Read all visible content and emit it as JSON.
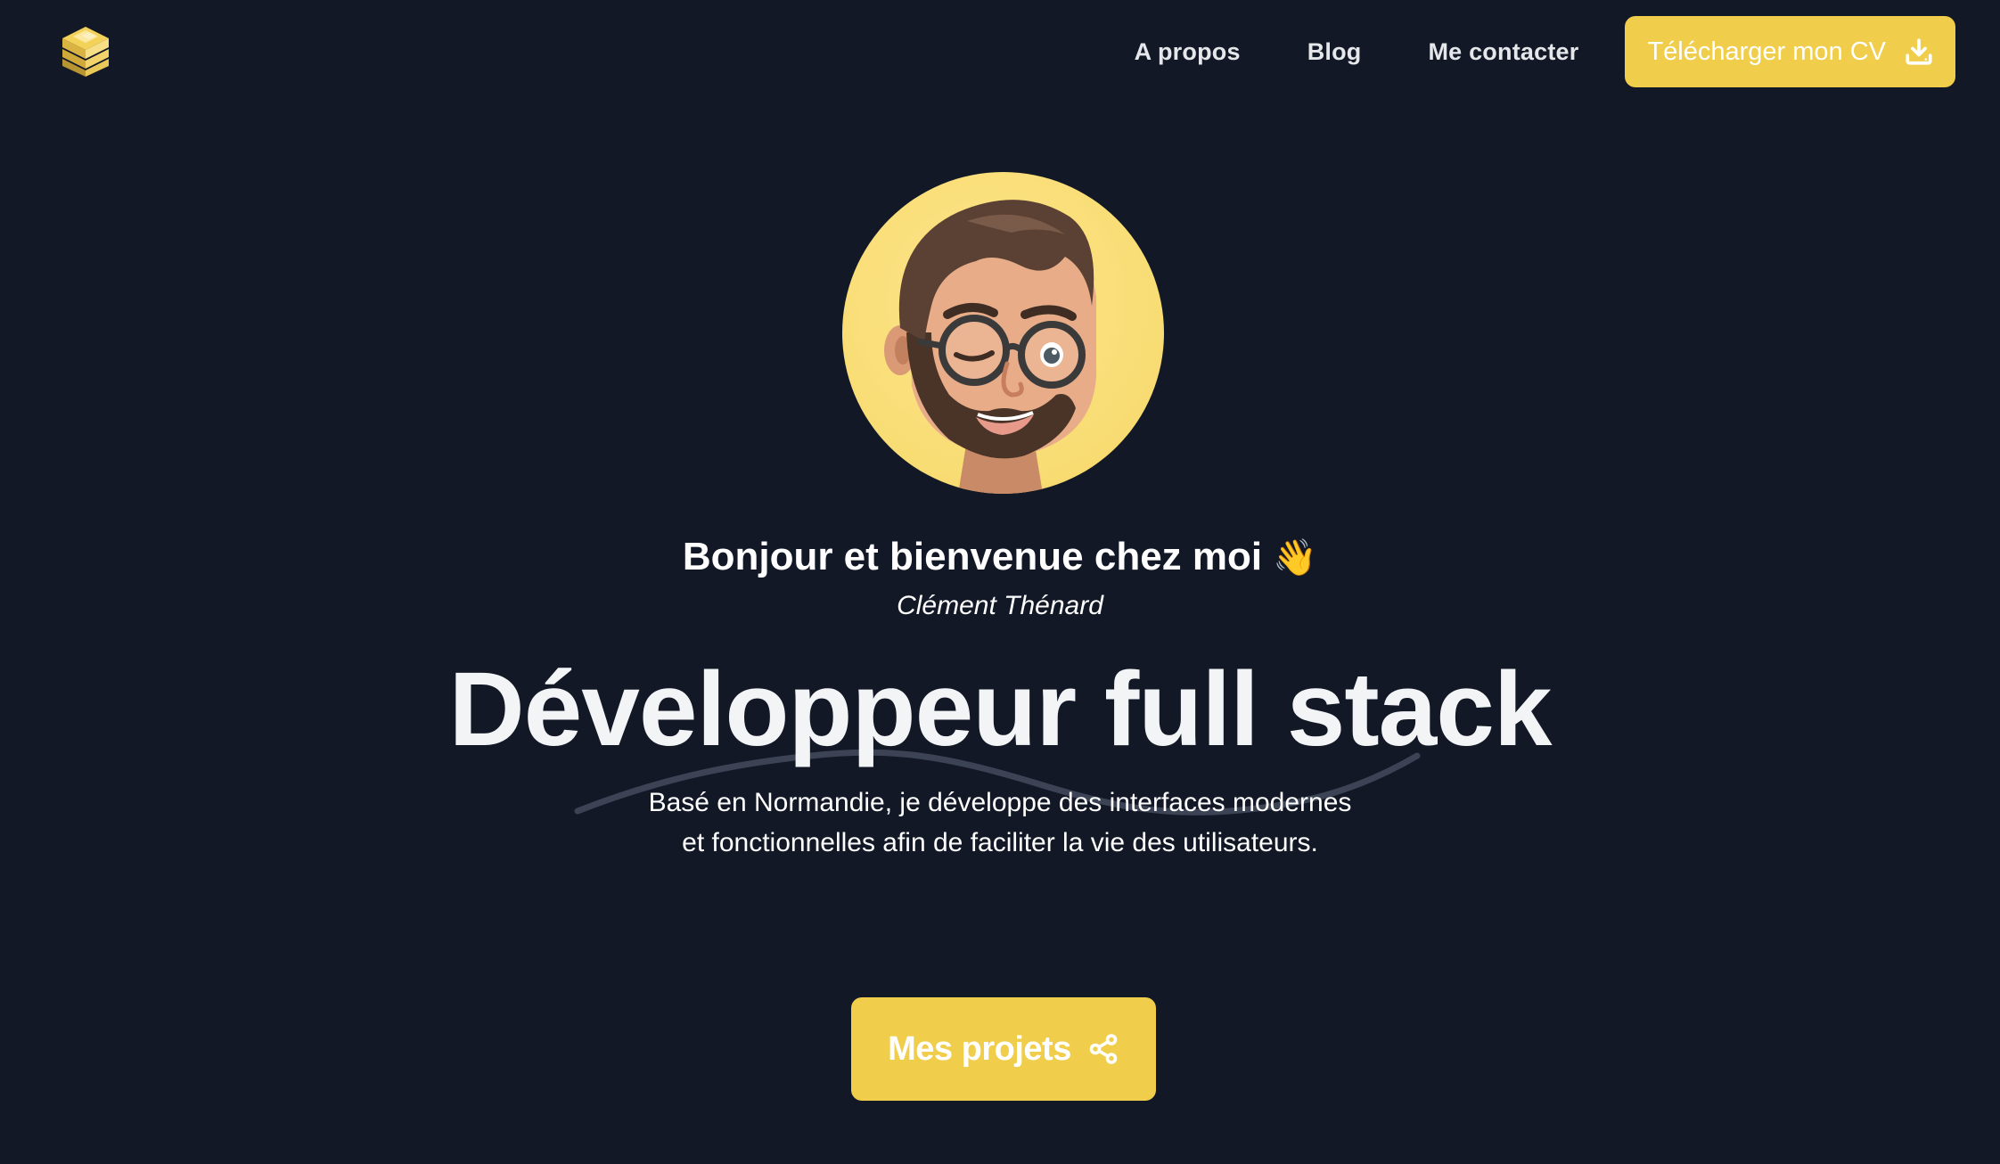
{
  "header": {
    "logo": "stacked-cubes-logo",
    "nav": [
      {
        "label": "A propos",
        "icon": null
      },
      {
        "label": "Blog",
        "icon": null
      },
      {
        "label": "Me contacter",
        "icon": null
      }
    ],
    "cv_button": {
      "label": "Télécharger mon CV",
      "icon": "download-icon"
    }
  },
  "hero": {
    "avatar": "memoji-avatar",
    "greeting": "Bonjour et bienvenue chez moi",
    "greeting_emoji": "👋",
    "author": "Clément Thénard",
    "headline": "Développeur full stack",
    "intro": "Basé en Normandie, je développe des interfaces modernes et fonctionnelles afin de faciliter la vie des utilisateurs.",
    "cta": {
      "label": "Mes projets",
      "icon": "share-icon"
    }
  },
  "colors": {
    "background": "#121826",
    "accent": "#f0cd4a",
    "text": "#f3f4f6"
  }
}
